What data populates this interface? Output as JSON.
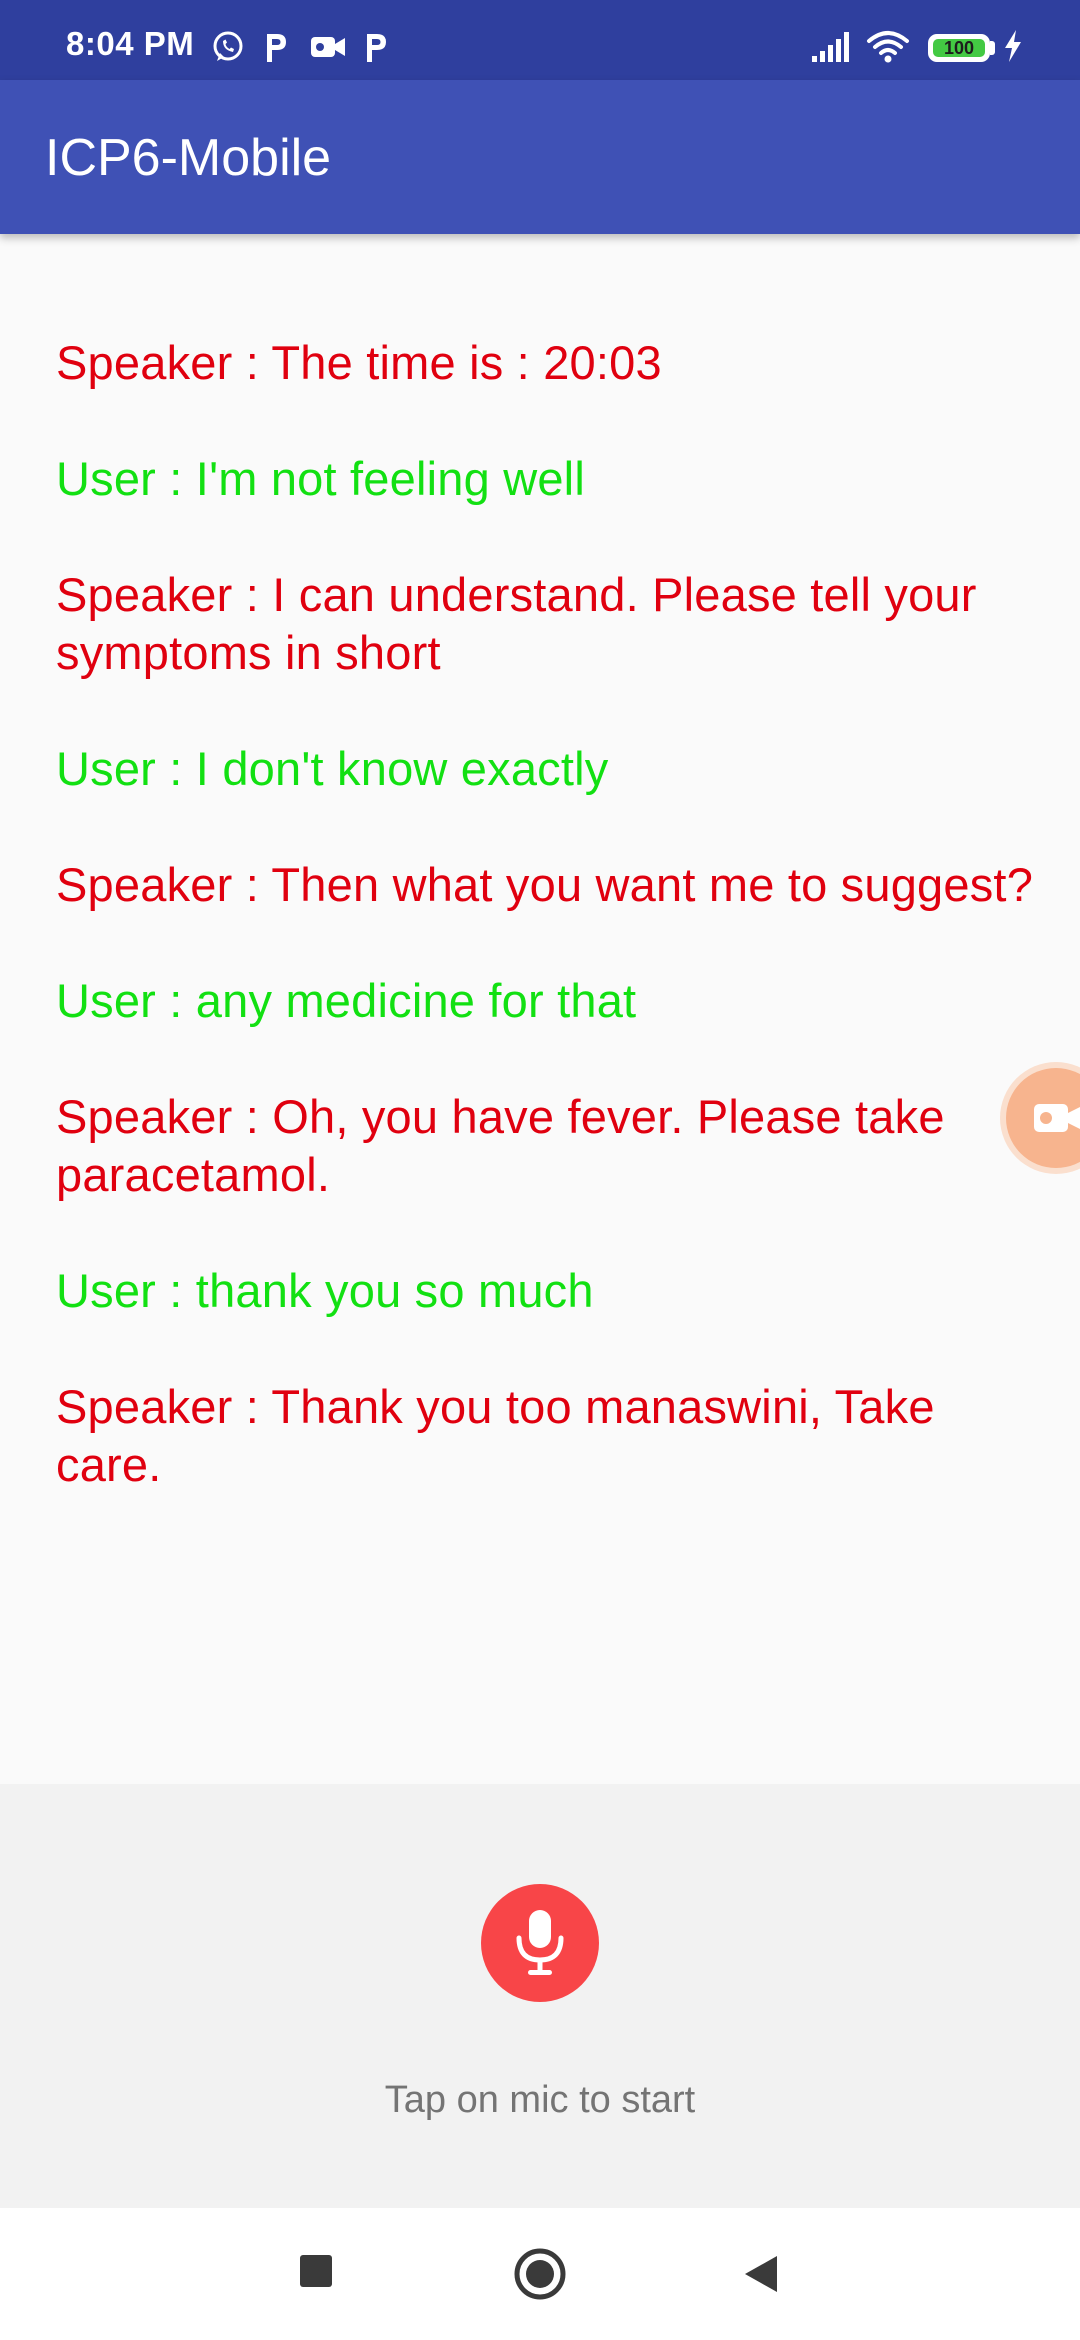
{
  "status_bar": {
    "time": "8:04 PM",
    "left_icons": [
      "whatsapp-icon",
      "p-icon",
      "video-camera-icon",
      "p-icon"
    ],
    "right_icons": [
      "signal-icon",
      "wifi-icon",
      "battery-icon",
      "charging-bolt-icon"
    ],
    "battery_level": "100",
    "colors": {
      "background": "#2f3f9e",
      "battery_fill": "#43c943"
    }
  },
  "app_bar": {
    "title": "ICP6-Mobile",
    "color": "#3f51b5"
  },
  "conversation": {
    "speaker_color": "#e0000f",
    "user_color": "#12e012",
    "messages": [
      {
        "role": "speaker",
        "text": "Speaker : The time is : 20:03"
      },
      {
        "role": "user",
        "text": "User : I'm not feeling well"
      },
      {
        "role": "speaker",
        "text": "Speaker : I can understand. Please tell your symptoms in short"
      },
      {
        "role": "user",
        "text": "User : I don't know exactly"
      },
      {
        "role": "speaker",
        "text": "Speaker : Then what you want me to suggest?"
      },
      {
        "role": "user",
        "text": "User : any medicine for that"
      },
      {
        "role": "speaker",
        "text": "Speaker : Oh, you have fever. Please take paracetamol."
      },
      {
        "role": "user",
        "text": "User : thank you so much"
      },
      {
        "role": "speaker",
        "text": "Speaker : Thank you too manaswini, Take care."
      }
    ]
  },
  "floating_bubble": {
    "icon": "video-camera-icon",
    "color": "#f7b48e"
  },
  "mic_panel": {
    "button_icon": "microphone-icon",
    "button_color": "#f84548",
    "hint": "Tap on mic to start"
  },
  "nav_bar": {
    "buttons": [
      {
        "icon": "recents-square-icon"
      },
      {
        "icon": "home-circle-icon"
      },
      {
        "icon": "back-triangle-icon"
      }
    ]
  }
}
